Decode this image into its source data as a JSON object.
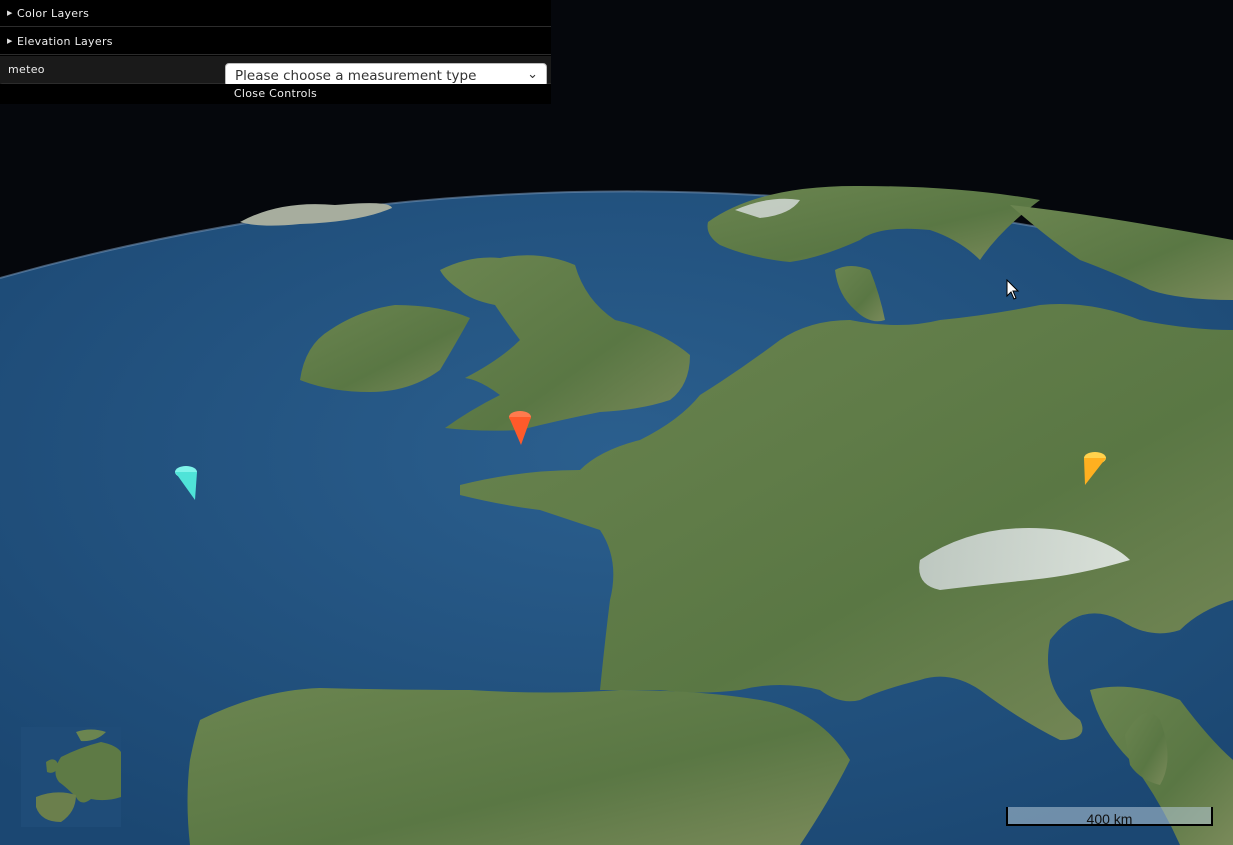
{
  "controls": {
    "folders": [
      {
        "label": "Color Layers"
      },
      {
        "label": "Elevation Layers"
      }
    ],
    "meteo": {
      "label": "meteo",
      "select_value": "Please choose a measurement type"
    },
    "close_label": "Close Controls"
  },
  "markers": [
    {
      "name": "cyan",
      "color": "#4fe3d8"
    },
    {
      "name": "orange-red",
      "color": "#ff5a2a"
    },
    {
      "name": "yellow",
      "color": "#ffb020"
    }
  ],
  "scale": {
    "label": "400 km"
  },
  "colors": {
    "space": "#05070c",
    "ocean": "#1f4f7c",
    "land": "#5e7a45",
    "panel": "#000000"
  }
}
